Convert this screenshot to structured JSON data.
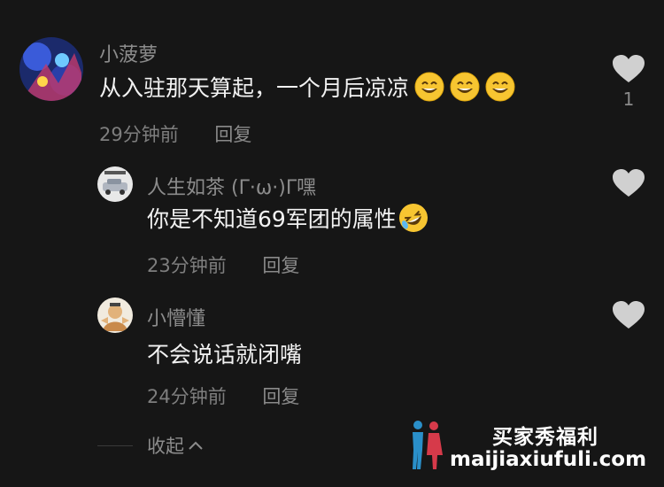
{
  "comments": [
    {
      "username": "小菠萝",
      "text": "从入驻那天算起，一个月后凉凉",
      "emoji": [
        "grinning-face-emoji",
        "grinning-face-emoji",
        "grinning-face-emoji"
      ],
      "time": "29分钟前",
      "reply_label": "回复",
      "likes": "1"
    },
    {
      "username": "人生如茶 (Γ·ω·)Γ嘿",
      "text": "你是不知道69军团的属性",
      "emoji": [
        "rolling-laughing-emoji"
      ],
      "time": "23分钟前",
      "reply_label": "回复"
    },
    {
      "username": "小懵懂",
      "text": "不会说话就闭嘴",
      "time": "24分钟前",
      "reply_label": "回复"
    }
  ],
  "collapse_label": "收起",
  "watermark": {
    "title": "买家秀福利",
    "url": "maijiaxiufuli.com"
  },
  "colors": {
    "background": "#161616",
    "username": "#8c8c8c",
    "text": "#f2f2f2",
    "meta": "#7e7e7e",
    "heart": "#d0d0d0"
  }
}
